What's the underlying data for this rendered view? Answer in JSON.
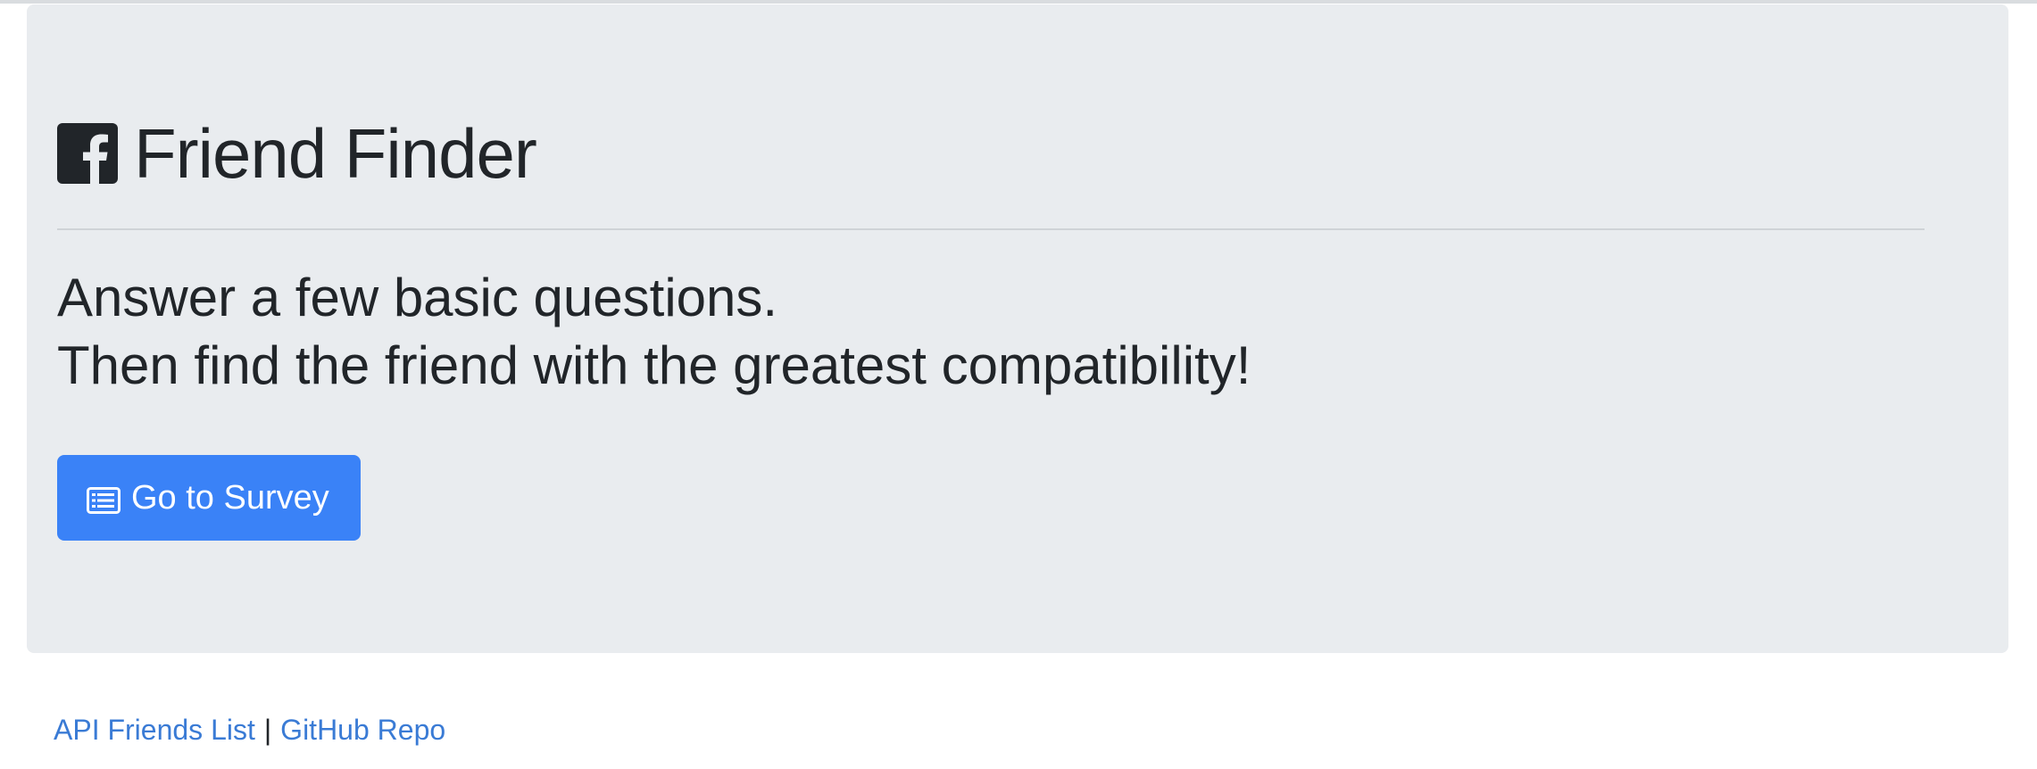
{
  "header": {
    "title": "Friend Finder",
    "logo_icon": "facebook-square-icon"
  },
  "lead": {
    "line1": "Answer a few basic questions.",
    "line2": "Then find the friend with the greatest compatibility!"
  },
  "survey_button": {
    "icon": "list-alt-icon",
    "label": "Go to Survey"
  },
  "footer": {
    "api_link": "API Friends List",
    "separator": "|",
    "github_link": "GitHub Repo"
  },
  "colors": {
    "jumbotron_bg": "#e9ecef",
    "primary": "#3a82f7",
    "link": "#3a7bd5",
    "text": "#212529"
  }
}
